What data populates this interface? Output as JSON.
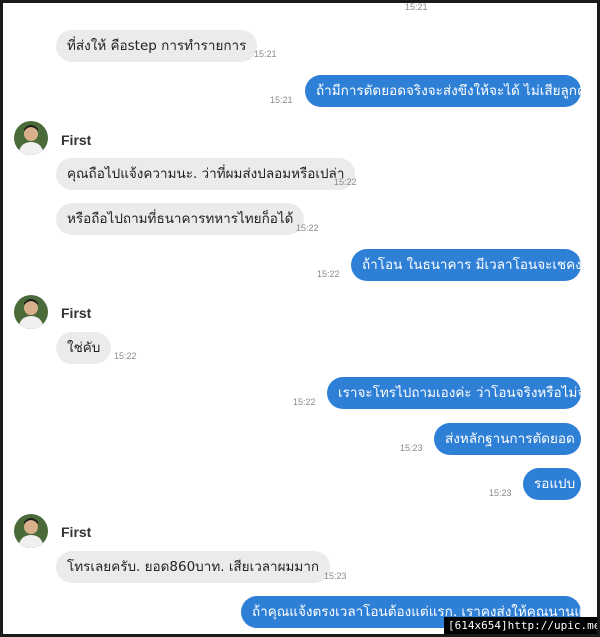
{
  "messages": [
    {
      "dir": "in",
      "text": "ที่ส่งให้ คือstep การทำรายการ",
      "time": "15:21"
    },
    {
      "dir": "out",
      "text": "ถ้ามีการตัดยอดจริงจะส่งขึงให้จะได้ ไม่เสียลูกค้า",
      "time": "15:21"
    },
    {
      "dir": "in",
      "text": "คุณถือไปแจ้งความนะ. ว่าที่ผมส่งปลอมหรือเปล่า",
      "time": "15:22"
    },
    {
      "dir": "in",
      "text": "หรือถือไปถามที่ธนาคารทหารไทยก็อได้",
      "time": "15:22"
    },
    {
      "dir": "out",
      "text": "ถ้าโอน ในธนาคาร มีเวลาโอนจะเชคง่าย",
      "time": "15:22"
    },
    {
      "dir": "in",
      "text": "ใช่คับ",
      "time": "15:22"
    },
    {
      "dir": "out",
      "text": "เราจะโทรไปถามเองค่ะ ว่าโอนจริงหรือไม่จริง",
      "time": "15:22"
    },
    {
      "dir": "out",
      "text": "ส่งหลักฐานการตัดยอด",
      "time": "15:23"
    },
    {
      "dir": "out",
      "text": "รอแปบ",
      "time": "15:23"
    },
    {
      "dir": "in",
      "text": "โทรเลยครับ. ยอด860บาท. เสียเวลาผมมาก",
      "time": "15:23"
    },
    {
      "dir": "out",
      "text": "ถ้าคุณแจ้งตรงเวลาโอนต้องแต่แรก. เราคงส่งให้คุณนานแล้",
      "time": ""
    }
  ],
  "top_time": "15:21",
  "sender_name": "First",
  "colors": {
    "outgoing": "#2e7fd6",
    "incoming": "#ebebeb"
  },
  "watermark": "[614x654]http://upic.me/"
}
